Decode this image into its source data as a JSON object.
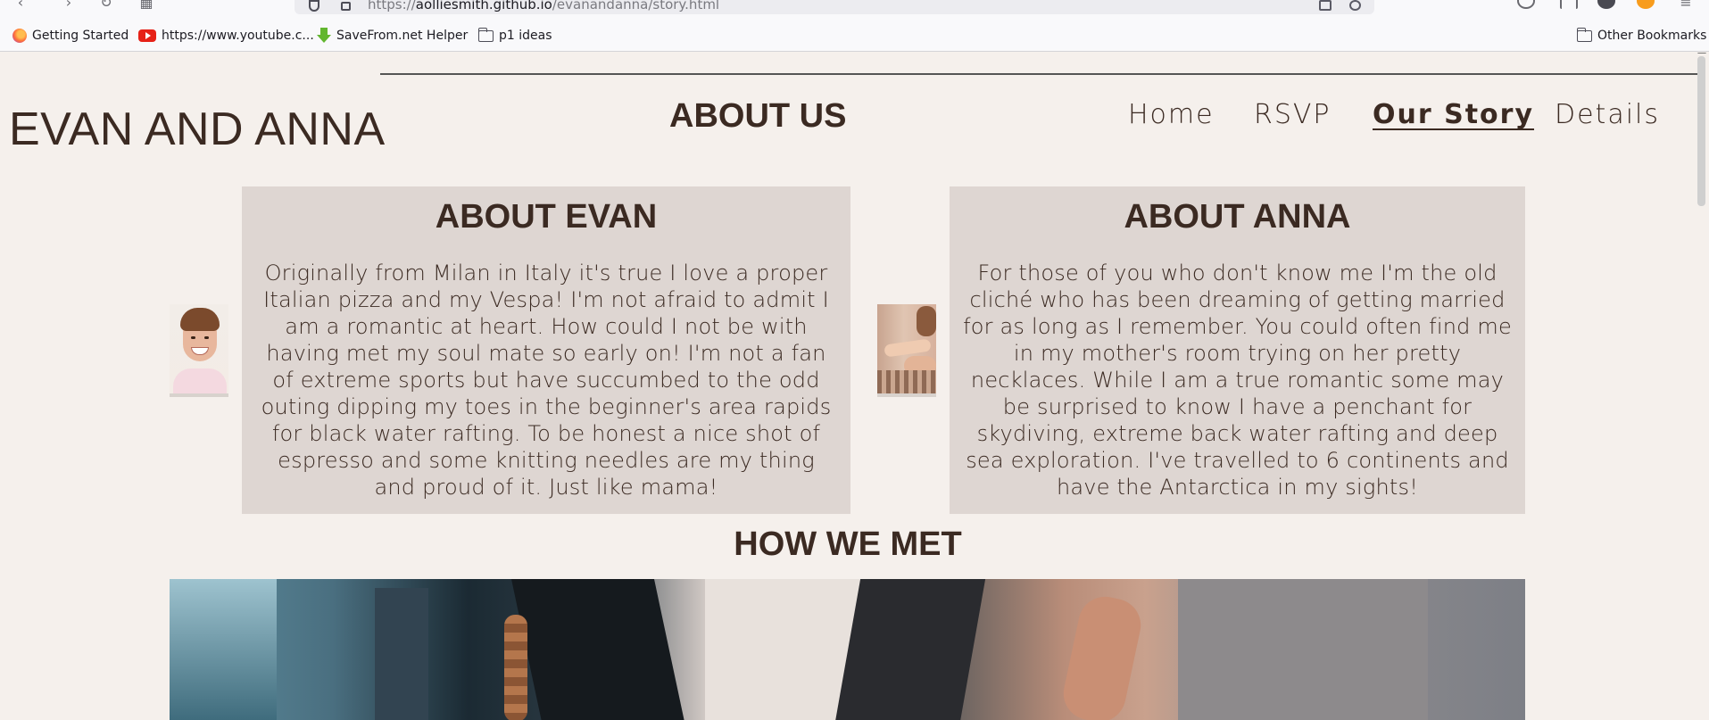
{
  "browser": {
    "url_host": "aolliesmith.github.io",
    "url_path": "/evanandanna/story.html",
    "url_scheme": "https://",
    "bookmarks": [
      {
        "label": "Getting Started",
        "icon": "firefox-icon"
      },
      {
        "label": "https://www.youtube.c...",
        "icon": "youtube-icon"
      },
      {
        "label": "SaveFrom.net Helper",
        "icon": "savefrom-icon"
      },
      {
        "label": "p1 ideas",
        "icon": "folder-icon"
      }
    ],
    "other_bookmarks": "Other Bookmarks"
  },
  "site": {
    "title": "EVAN AND ANNA",
    "section_title": "ABOUT US",
    "nav": [
      {
        "label": "Home",
        "active": false
      },
      {
        "label": "RSVP",
        "active": false
      },
      {
        "label": "Our Story",
        "active": true
      },
      {
        "label": "Details",
        "active": false
      }
    ]
  },
  "about_evan": {
    "title": "ABOUT EVAN",
    "text": "Originally from Milan in Italy it's true I love a proper Italian pizza and my Vespa! I'm not afraid to admit I am a romantic at heart. How could I not be with having met my soul mate so early on! I'm not a fan of extreme sports but have succumbed to the odd outing dipping my toes in the beginner's area rapids for black water rafting. To be honest a nice shot of espresso and some knitting needles are my thing and proud of it. Just like mama!"
  },
  "about_anna": {
    "title": "ABOUT ANNA",
    "text": "For those of you who don't know me I'm the old cliché who has been dreaming of getting married for as long as I remember. You could often find me in my mother's room trying on her pretty necklaces. While I am a true romantic some may be surprised to know I have a penchant for skydiving, extreme back water rafting and deep sea exploration. I've travelled to 6 continents and have the Antarctica in my sights!"
  },
  "how_we_met": {
    "title": "HOW WE MET"
  },
  "colors": {
    "page_bg": "#f5f0ec",
    "card_bg": "#ded6d2",
    "text": "#3b2a22"
  }
}
